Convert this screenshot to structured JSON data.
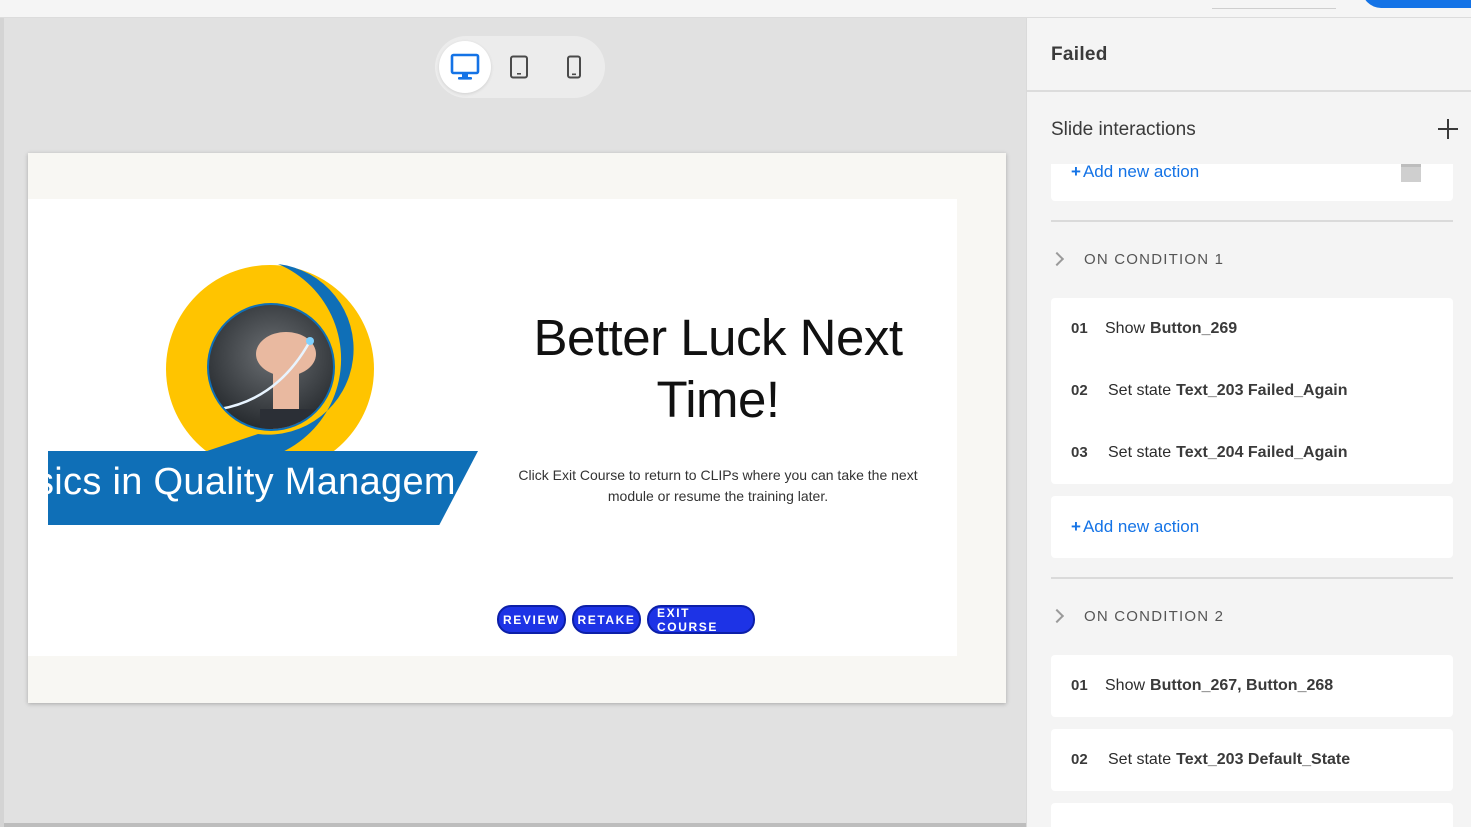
{
  "device_switcher": {
    "active": "desktop",
    "devices": [
      "desktop-icon",
      "tablet-icon",
      "mobile-icon"
    ]
  },
  "slide": {
    "banner_text": "sics in Quality Managem",
    "headline_line1": "Better Luck Next",
    "headline_line2": "Time!",
    "body_text": "Click Exit Course to return to CLIPs where you can take the next module or resume the training later.",
    "buttons": {
      "review": "REVIEW",
      "retake": "RETAKE",
      "exit": "EXIT COURSE"
    }
  },
  "panel": {
    "title": "Failed",
    "section_title": "Slide interactions",
    "add_new_action": "Add new action",
    "conditions": [
      {
        "label": "ON CONDITION 1",
        "actions": [
          {
            "num": "01",
            "verb": "Show",
            "target": "Button_269"
          },
          {
            "num": "02",
            "verb": "Set state",
            "target": "Text_203 Failed_Again"
          },
          {
            "num": "03",
            "verb": "Set state",
            "target": "Text_204 Failed_Again"
          }
        ]
      },
      {
        "label": "ON CONDITION 2",
        "actions": [
          {
            "num": "01",
            "verb": "Show",
            "target": "Button_267, Button_268"
          },
          {
            "num": "02",
            "verb": "Set state",
            "target": "Text_203 Default_State"
          }
        ]
      }
    ]
  },
  "colors": {
    "accent": "#1473e6",
    "slide_button": "#1d33e6",
    "logo_yellow": "#ffc400",
    "logo_blue": "#0f6fb7"
  }
}
